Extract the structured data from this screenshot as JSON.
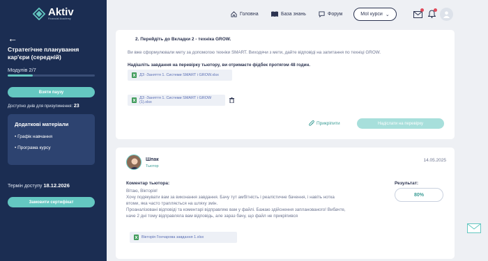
{
  "brand": {
    "name": "Aktiv",
    "tagline": "Financial Academy"
  },
  "sidebar": {
    "course_title": "Стратегічне планування кар'єри (середній)",
    "modules": "Модулів 2/7",
    "progress": 0.29,
    "pause_button": "Взяти паузу",
    "days_label": "Доступно днів для призупинення:",
    "days_value": "23",
    "materials_title": "Додаткові матеріали",
    "materials": [
      "• Графік навчання",
      "• Програма курсу"
    ],
    "access_label": "Термін доступу",
    "access_value": "18.12.2026",
    "certificate_button": "Замовити сертифікат"
  },
  "nav": {
    "home": "Головна",
    "knowledge": "База знань",
    "forum": "Форум",
    "my_courses": "Мої курси"
  },
  "task": {
    "step_title": "2. Перейдіть до Вкладки 2 - техніка GROW.",
    "intro": "Ви вже сформулювали мету за допомогою техніки SMART. Виходячи з мети, дайте відповіді на запитання по техніці GROW.",
    "submit_note": "Надішліть завдання на перевірку тьютору, ви отримаєте фідбек протягом 48 годин.",
    "file1": "ДЗ -Заняття 1. Системи SMART і GROW.xlsx",
    "file2_line1": "ДЗ -Заняття 1. Системи SMART і GROW",
    "file2_line2": "(1).xlsx",
    "attach": "Прикріпити",
    "send": "Надіслати на перевірку"
  },
  "review": {
    "tutor_name": "Шпак",
    "tutor_role": "Тьютор",
    "date": "14.05.2025",
    "comment_title": "Коментар тьютора:",
    "lines": [
      "Вітаю, Вікторія!",
      "Хочу подякувати вам за виконання завдання. Бачу тут амбітність і реалістичне бачення, і навіть нотка",
      "втоми, яка часто трапляється на шляху змін.",
      "Проаналізовані відповіді та коментарі відправляю вам у файлі. Бажаю здійснення запланованого!  Вибачте,",
      "наче 2 дні тому відправляла вам відповідь, але зараз бачу, що файл не прикріпився"
    ],
    "result_title": "Результат:",
    "result_value": "80%",
    "file": "Вікторія Гончарова завдання 1.xlsx"
  },
  "colors": {
    "sidebar": "#1b2d52",
    "accent": "#64c7c1",
    "badge": "#e04a5a"
  }
}
